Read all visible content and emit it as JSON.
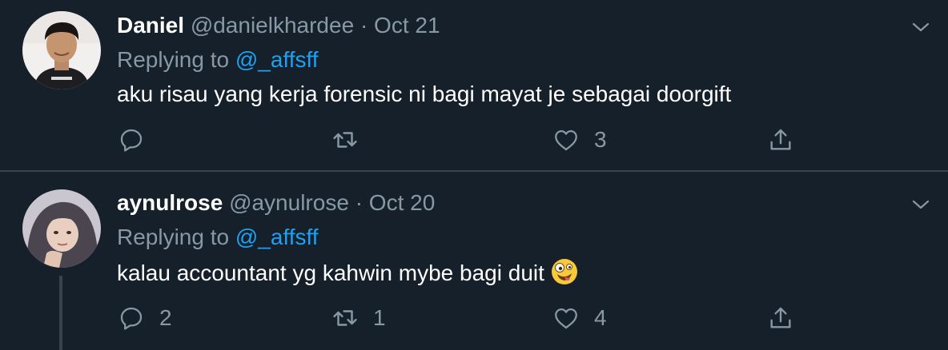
{
  "tweets": [
    {
      "name": "Daniel",
      "handle": "@danielkhardee",
      "separator": "·",
      "date": "Oct 21",
      "replying_prefix": "Replying to",
      "replying_to": "@_affsff",
      "text": "aku risau yang kerja forensic ni bagi mayat je sebagai doorgift",
      "reply_count": "",
      "retweet_count": "",
      "like_count": "3"
    },
    {
      "name": "aynulrose",
      "handle": "@aynulrose",
      "separator": "·",
      "date": "Oct 20",
      "replying_prefix": "Replying to",
      "replying_to": "@_affsff",
      "text": "kalau accountant yg kahwin mybe bagi duit",
      "reply_count": "2",
      "retweet_count": "1",
      "like_count": "4"
    }
  ],
  "icons": {
    "reply": "reply-icon",
    "retweet": "retweet-icon",
    "like": "heart-icon",
    "share": "share-icon",
    "caret": "chevron-down-icon",
    "emoji": "zany-face-emoji"
  },
  "colors": {
    "background": "#15202b",
    "secondary_text": "#8899a6",
    "link": "#1da1f2",
    "divider": "#38444d"
  }
}
